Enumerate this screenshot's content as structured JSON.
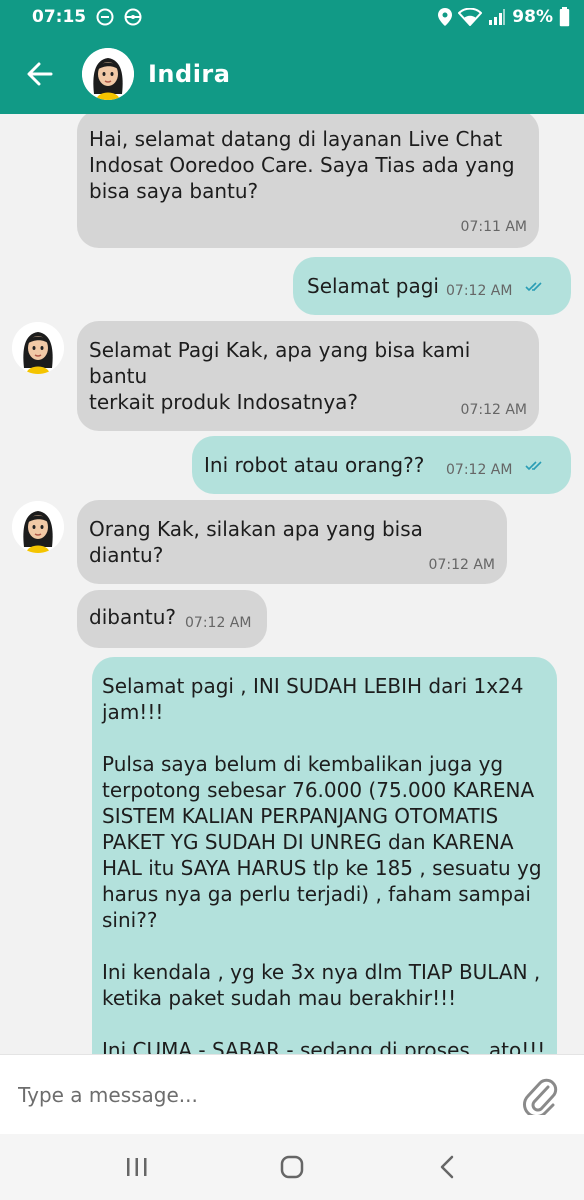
{
  "status_bar": {
    "time": "07:15",
    "battery": "98%"
  },
  "header": {
    "contact_name": "Indira"
  },
  "messages": [
    {
      "sender": "agent",
      "text": "Hai, selamat datang di layanan Live Chat\nIndosat Ooredoo Care. Saya Tias ada yang\nbisa saya bantu?",
      "time": "07:11 AM"
    },
    {
      "sender": "user",
      "text": "Selamat pagi",
      "time": "07:12 AM"
    },
    {
      "sender": "agent",
      "text": "Selamat Pagi Kak, apa yang bisa kami bantu\nterkait produk Indosatnya?",
      "time": "07:12 AM"
    },
    {
      "sender": "user",
      "text": "Ini robot atau orang??",
      "time": "07:12 AM"
    },
    {
      "sender": "agent",
      "text": "Orang Kak, silakan apa yang bisa diantu?",
      "time": "07:12 AM"
    },
    {
      "sender": "agent",
      "text": "dibantu?",
      "time": "07:12 AM"
    },
    {
      "sender": "user",
      "text": "Selamat pagi , INI SUDAH LEBIH dari 1x24\njam!!!\n\nPulsa saya belum di kembalikan juga yg\nterpotong sebesar 76.000 (75.000 KARENA\nSISTEM KALIAN PERPANJANG OTOMATIS\nPAKET YG SUDAH DI UNREG dan KARENA\nHAL itu SAYA HARUS tlp ke 185 , sesuatu yg\nharus nya ga perlu terjadi) , faham sampai\nsini??\n\nIni kendala , yg ke 3x nya dlm TIAP BULAN ,\nketika paket sudah mau berakhir!!!\n\nIni CUMA - SABAR - sedang di proses , ato!!!",
      "time": ""
    }
  ],
  "input": {
    "placeholder": "Type a message..."
  },
  "colors": {
    "header": "#119a86",
    "agent_bubble": "#d5d5d5",
    "user_bubble": "#b3e1dc",
    "read_check": "#2a9db5"
  },
  "icons": {
    "back": "arrow-left-icon",
    "attach": "paperclip-icon",
    "scroll_down": "chevron-down-icon",
    "nav_recent": "recent-apps-icon",
    "nav_home": "home-icon",
    "nav_back": "nav-back-icon"
  }
}
